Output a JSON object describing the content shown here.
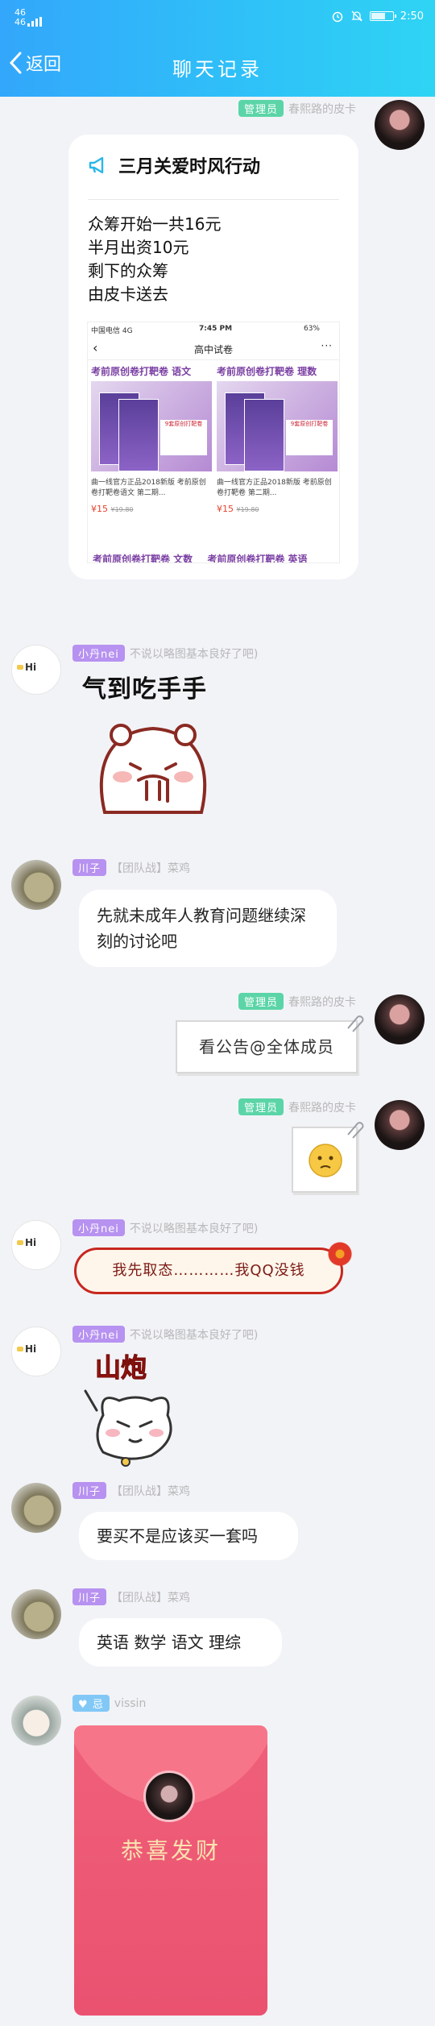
{
  "status_bar": {
    "carrier_top": "46",
    "carrier_bottom": "46",
    "time": "2:50"
  },
  "header": {
    "back_label": "返回",
    "title": "聊天记录",
    "gradient_colors": [
      "#33a7fb",
      "#2fd4f4"
    ]
  },
  "messages": [
    {
      "id": "m1",
      "tag": "管理员",
      "tag_color": "#5bd5a7",
      "name": "春熙路的皮卡",
      "card": {
        "heading": "三月关爱时风行动",
        "lines": [
          "众筹开始一共16元",
          "半月出资10元",
          "剩下的众筹",
          "由皮卡送去"
        ],
        "screenshot": {
          "carrier": "中国电信 4G",
          "time": "7:45 PM",
          "battery": "63%",
          "page_title": "高中试卷",
          "products": [
            {
              "title": "考前原创卷打靶卷 语文",
              "cover_title": "考前原创卷",
              "sticker": "9套原创打靶卷",
              "desc": "曲一线官方正品2018新版 考前原创卷打靶卷语文 第二期...",
              "price": "¥15",
              "old_price": "¥19.80"
            },
            {
              "title": "考前原创卷打靶卷 理数",
              "cover_title": "考前原创卷",
              "sticker": "9套原创打靶卷",
              "desc": "曲一线官方正品2018新版 考前原创卷打靶卷 第二期...",
              "price": "¥15",
              "old_price": "¥19.80"
            }
          ],
          "more_row": [
            "考前原创卷打靶卷 文数",
            "考前原创卷打靶卷 英语"
          ]
        }
      }
    },
    {
      "id": "m2",
      "tag": "小丹nei",
      "tag_color": "#b792f0",
      "name": "不说以略图基本良好了吧)",
      "avatar_text": "Hi",
      "sticker_text": "气到吃手手"
    },
    {
      "id": "m3",
      "tag": "川子",
      "name": "【团队战】菜鸡",
      "text": "先就未成年人教育问题继续深刻的讨论吧"
    },
    {
      "id": "m4",
      "tag": "管理员",
      "name": "春熙路的皮卡",
      "note_text": "看公告@全体成员"
    },
    {
      "id": "m5",
      "tag": "管理员",
      "name": "春熙路的皮卡"
    },
    {
      "id": "m6",
      "tag": "小丹nei",
      "name": "不说以略图基本良好了吧)",
      "avatar_text": "Hi",
      "label_text": "我先取态…………我QQ没钱"
    },
    {
      "id": "m7",
      "tag": "小丹nei",
      "name": "不说以略图基本良好了吧)",
      "avatar_text": "Hi",
      "sticker_text": "山炮"
    },
    {
      "id": "m8",
      "tag": "川子",
      "name": "【团队战】菜鸡",
      "text": "要买不是应该买一套吗"
    },
    {
      "id": "m9",
      "tag": "川子",
      "name": "【团队战】菜鸡",
      "text": "英语 数学 语文 理综"
    },
    {
      "id": "m10",
      "tag": "♥ 忌",
      "tag_color": "#82c8f6",
      "name": "vissin",
      "redpacket_text": "恭喜发财",
      "redpacket_color": "#ea5270"
    }
  ]
}
